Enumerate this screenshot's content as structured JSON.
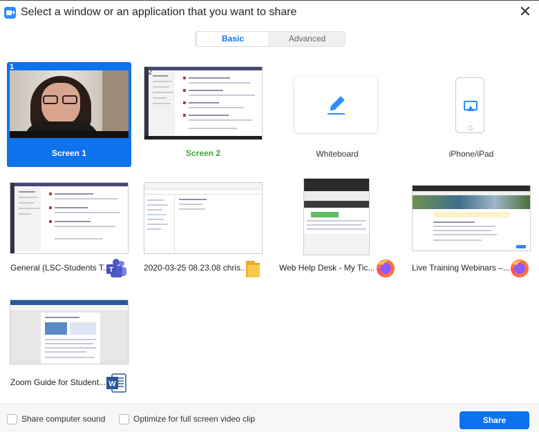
{
  "window": {
    "title": "Select a window or an application that you want to share",
    "close_glyph": "✕"
  },
  "tabs": [
    {
      "label": "Basic",
      "active": true
    },
    {
      "label": "Advanced",
      "active": false
    }
  ],
  "tiles": [
    {
      "label": "Screen 1",
      "number": "1",
      "selected": true,
      "kind": "screen"
    },
    {
      "label": "Screen 2",
      "number": "2",
      "selected": false,
      "kind": "screen"
    },
    {
      "label": "Whiteboard",
      "kind": "whiteboard",
      "icon": "pen-icon"
    },
    {
      "label": "iPhone/iPad",
      "kind": "device",
      "icon": "airplay-icon"
    },
    {
      "label": "General (LSC-Students T...",
      "kind": "window",
      "app_icon": "teams-icon"
    },
    {
      "label": "2020-03-25 08.23.08 chris...",
      "kind": "window",
      "app_icon": "folder-icon"
    },
    {
      "label": "Web Help Desk - My Tic...",
      "kind": "window",
      "app_icon": "firefox-icon"
    },
    {
      "label": "Live Training Webinars –...",
      "kind": "window",
      "app_icon": "firefox-icon"
    },
    {
      "label": "Zoom Guide for Student...",
      "kind": "window",
      "app_icon": "word-icon"
    }
  ],
  "footer": {
    "share_sound_label": "Share computer sound",
    "share_sound_checked": false,
    "optimize_label": "Optimize for full screen video clip",
    "optimize_checked": false,
    "share_button_label": "Share"
  },
  "colors": {
    "accent": "#0e72ed",
    "screen2_label": "#3aa635",
    "teams": "#5059c9",
    "word": "#2b579a",
    "folder": "#f8c84a",
    "firefox_orange": "#ff7139",
    "firefox_purple": "#9059ff"
  }
}
